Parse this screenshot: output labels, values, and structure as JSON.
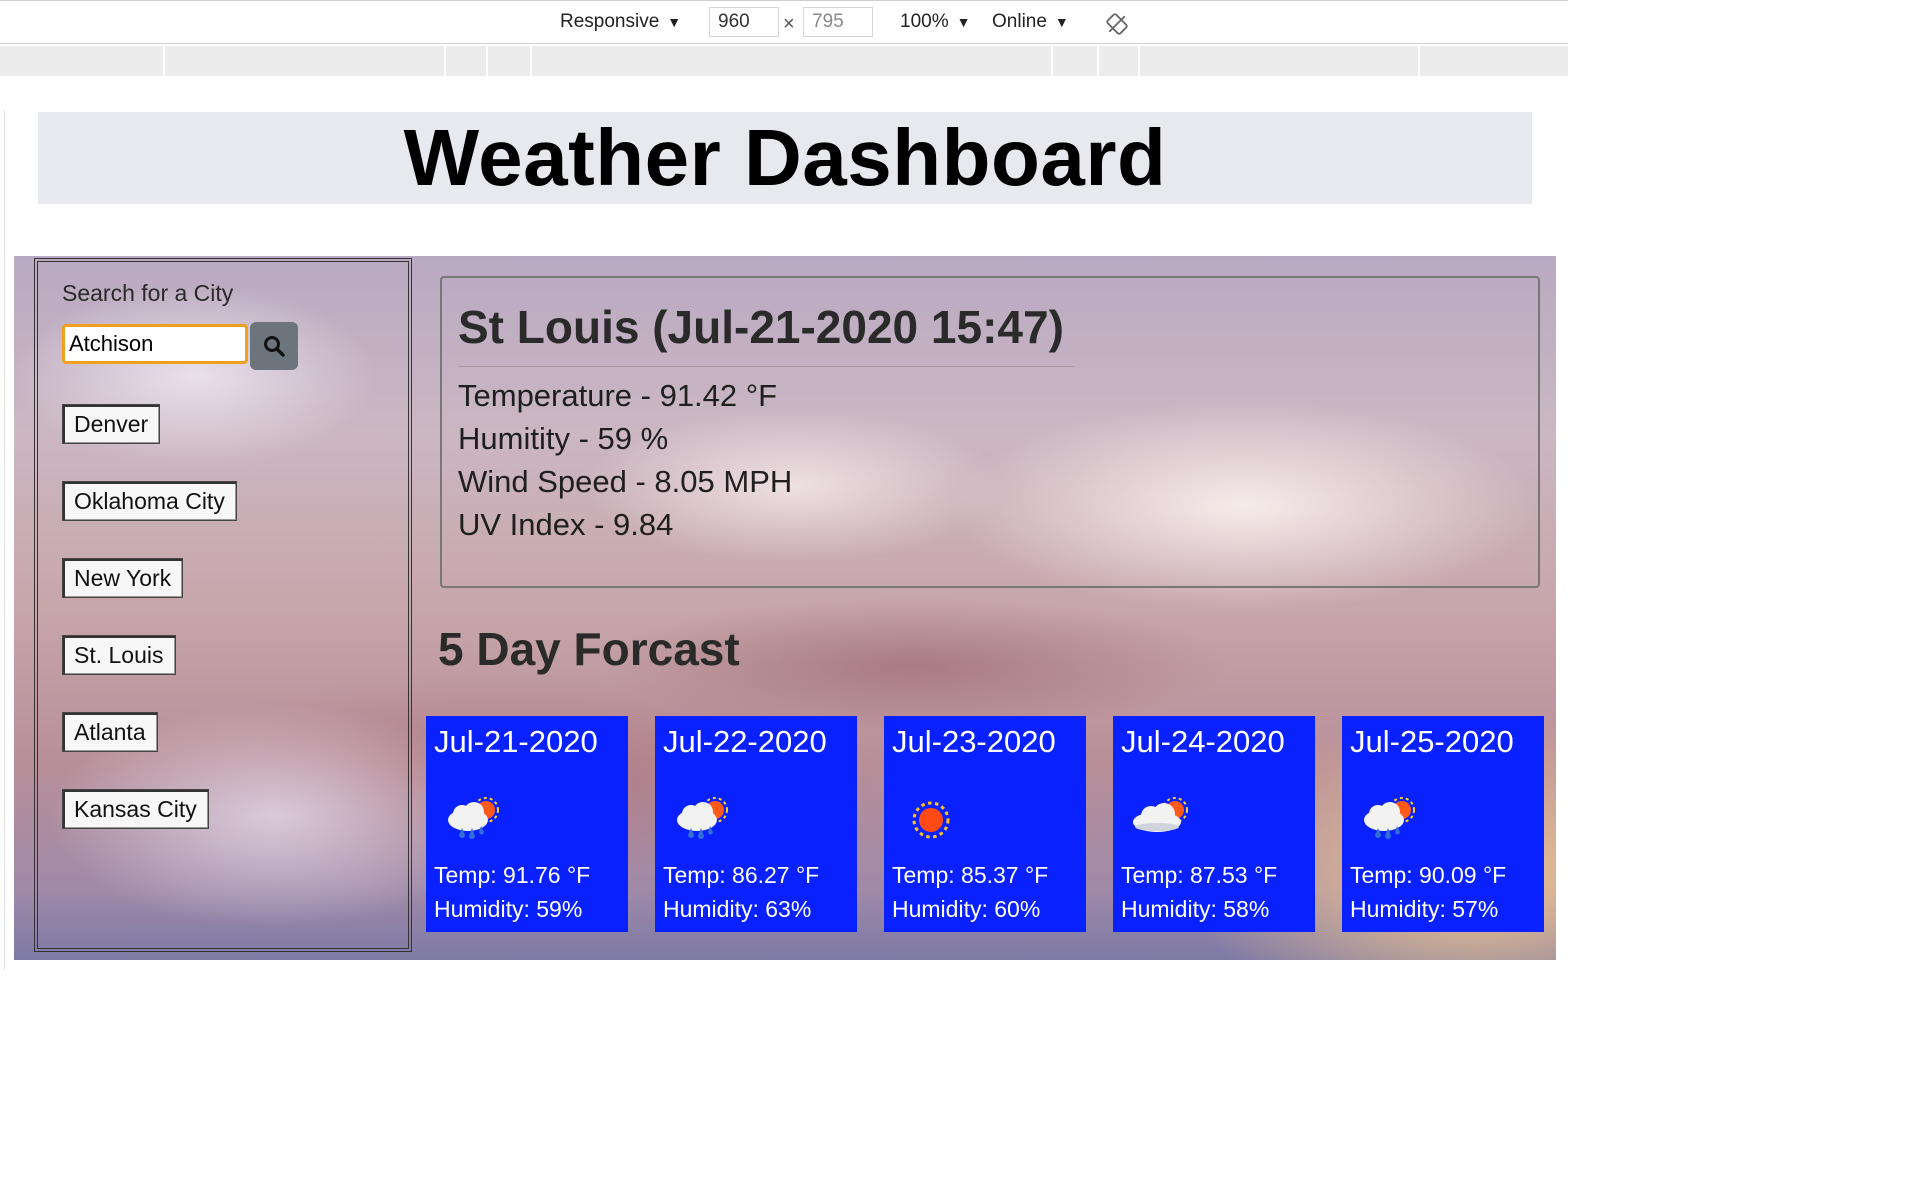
{
  "devtools": {
    "device": "Responsive",
    "width": "960",
    "height": "795",
    "zoom": "100%",
    "network": "Online"
  },
  "page": {
    "title": "Weather Dashboard"
  },
  "sidebar": {
    "search_label": "Search for a City",
    "search_value": "Atchison",
    "cities": [
      "Denver",
      "Oklahoma City",
      "New York",
      "St. Louis",
      "Atlanta",
      "Kansas City"
    ]
  },
  "current": {
    "title": "St Louis (Jul-21-2020 15:47)",
    "temperature": "Temperature - 91.42 °F",
    "humidity": "Humitity - 59 %",
    "wind": "Wind Speed - 8.05 MPH",
    "uv": "UV Index - 9.84"
  },
  "forecast": {
    "heading": "5 Day Forcast",
    "days": [
      {
        "date": "Jul-21-2020",
        "icon": "rain-sun-icon",
        "temp": "Temp: 91.76 °F",
        "humidity": "Humidity: 59%"
      },
      {
        "date": "Jul-22-2020",
        "icon": "rain-sun-icon",
        "temp": "Temp: 86.27 °F",
        "humidity": "Humidity: 63%"
      },
      {
        "date": "Jul-23-2020",
        "icon": "sun-icon",
        "temp": "Temp: 85.37 °F",
        "humidity": "Humidity: 60%"
      },
      {
        "date": "Jul-24-2020",
        "icon": "cloud-sun-icon",
        "temp": "Temp: 87.53 °F",
        "humidity": "Humidity: 58%"
      },
      {
        "date": "Jul-25-2020",
        "icon": "rain-sun-icon",
        "temp": "Temp: 90.09 °F",
        "humidity": "Humidity: 57%"
      }
    ]
  },
  "colors": {
    "card_bg": "#0a21ff",
    "search_button": "#6c757d",
    "input_focus": "#f0a020"
  }
}
